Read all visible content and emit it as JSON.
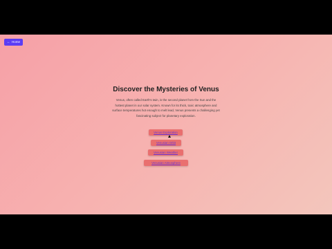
{
  "nav": {
    "home_label": "Home"
  },
  "page": {
    "title": "Discover the Mysteries of Venus",
    "description": "Venus, often called Earth's twin, is the second planet from the Sun and the hottest planet in our solar system. Known for its thick, toxic atmosphere and surface temperatures hot enough to melt lead, Venus presents a challenging yet fascinating subject for planetary exploration."
  },
  "links": [
    {
      "label": "Venus Exploration"
    },
    {
      "label": "Venusian Orbit"
    },
    {
      "label": "Venusian Weather"
    },
    {
      "label": "Venusian Atmosphere"
    }
  ],
  "colors": {
    "home_button": "#5b3df5",
    "link_button": "#e96f6f",
    "link_text": "#6a36d4"
  }
}
